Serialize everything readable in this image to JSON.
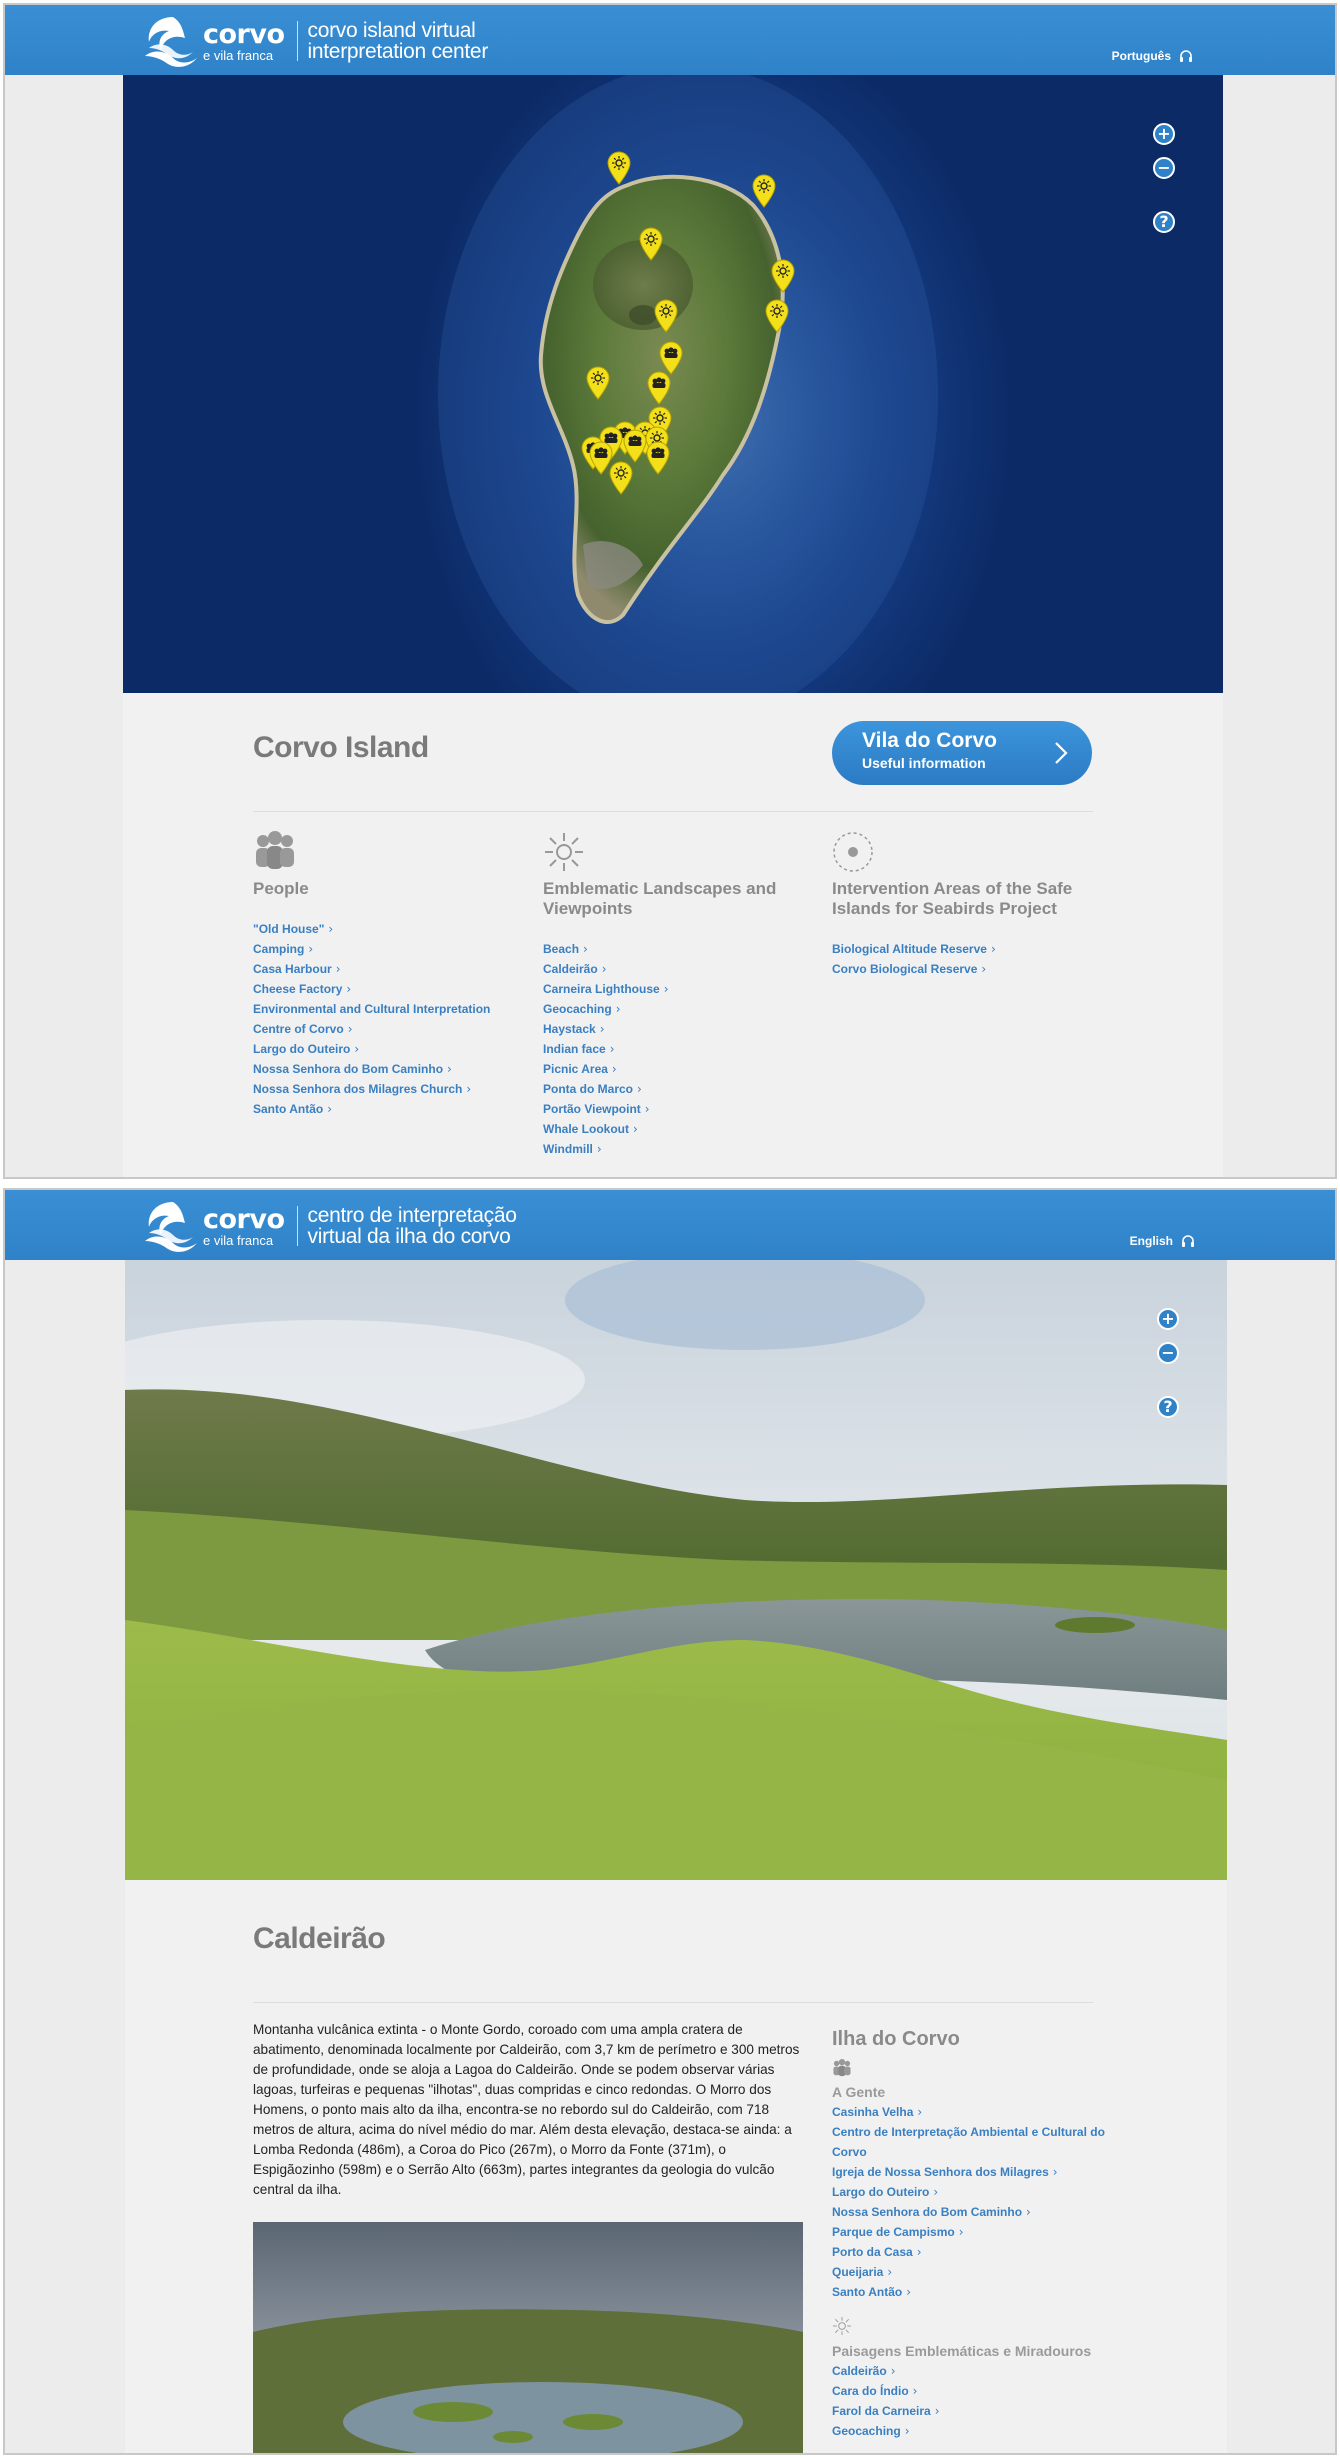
{
  "screen_en": {
    "header": {
      "logo_word": "corvo",
      "logo_sub": "e vila franca",
      "tagline_1": "corvo island virtual",
      "tagline_2": "interpretation center",
      "language_link": "Português"
    },
    "map": {
      "zoom_in": "+",
      "zoom_out": "−",
      "help": "?"
    },
    "title": "Corvo Island",
    "cta": {
      "title": "Vila do Corvo",
      "subtitle": "Useful information"
    },
    "categories": [
      {
        "icon": "people-icon",
        "title": "People",
        "links": [
          "\"Old House\"",
          "Camping",
          "Casa Harbour",
          "Cheese Factory",
          "Environmental and Cultural Interpretation",
          "Centre of Corvo",
          "Largo do Outeiro",
          "Nossa Senhora do Bom Caminho",
          "Nossa Senhora dos Milagres Church",
          "Santo Antão"
        ],
        "chevrons": [
          true,
          true,
          true,
          true,
          false,
          true,
          true,
          true,
          true,
          true
        ]
      },
      {
        "icon": "sun-icon",
        "title_1": "Emblematic Landscapes and",
        "title_2": "Viewpoints",
        "links": [
          "Beach",
          "Caldeirão",
          "Carneira Lighthouse",
          "Geocaching",
          "Haystack",
          "Indian face",
          "Picnic Area",
          "Ponta do Marco",
          "Portão Viewpoint",
          "Whale Lookout",
          "Windmill"
        ]
      },
      {
        "icon": "target-icon",
        "title_1": "Intervention Areas of the Safe",
        "title_2": "Islands for Seabirds Project",
        "links": [
          "Biological Altitude Reserve",
          "Corvo Biological Reserve"
        ]
      }
    ]
  },
  "screen_pt": {
    "header": {
      "logo_word": "corvo",
      "logo_sub": "e vila franca",
      "tagline_1": "centro de interpretação",
      "tagline_2": "virtual da ilha do corvo",
      "language_link": "English"
    },
    "controls": {
      "zoom_in": "+",
      "zoom_out": "−",
      "help": "?"
    },
    "title": "Caldeirão",
    "paragraph": "Montanha vulcânica extinta - o Monte Gordo, coroado com uma ampla cratera de abatimento, denominada localmente por Caldeirão, com 3,7 km de perímetro e 300 metros de profundidade, onde se aloja a Lagoa do Caldeirão. Onde se podem observar várias lagoas, turfeiras e pequenas \"ilhotas\", duas compridas e cinco redondas. O Morro dos Homens, o ponto mais alto da ilha, encontra-se no rebordo sul do Caldeirão, com 718 metros de altura, acima do nível médio do mar. Além desta elevação, destaca-se ainda: a Lomba Redonda (486m), a Coroa do Pico (267m), o Morro da Fonte (371m), o Espigãozinho (598m) e o Serrão Alto (663m), partes integrantes da geologia do vulcão central da ilha.",
    "sidebar": {
      "title": "Ilha do Corvo",
      "group1_title": "A Gente",
      "group1_links": [
        "Casinha Velha",
        "Centro de Interpretação Ambiental e Cultural do Corvo",
        "Igreja de Nossa Senhora dos Milagres",
        "Largo do Outeiro",
        "Nossa Senhora do Bom Caminho",
        "Parque de Campismo",
        "Porto da Casa",
        "Queijaria",
        "Santo Antão"
      ],
      "group2_title": "Paisagens Emblemáticas e Miradouros",
      "group2_links": [
        "Caldeirão",
        "Cara do Índio",
        "Farol da Carneira",
        "Geocaching"
      ]
    }
  },
  "colors": {
    "brand_blue": "#2f82c8",
    "link_blue": "#3a7fc1",
    "pin_yellow": "#f3e01a",
    "heading_gray": "#7a7a7a"
  }
}
